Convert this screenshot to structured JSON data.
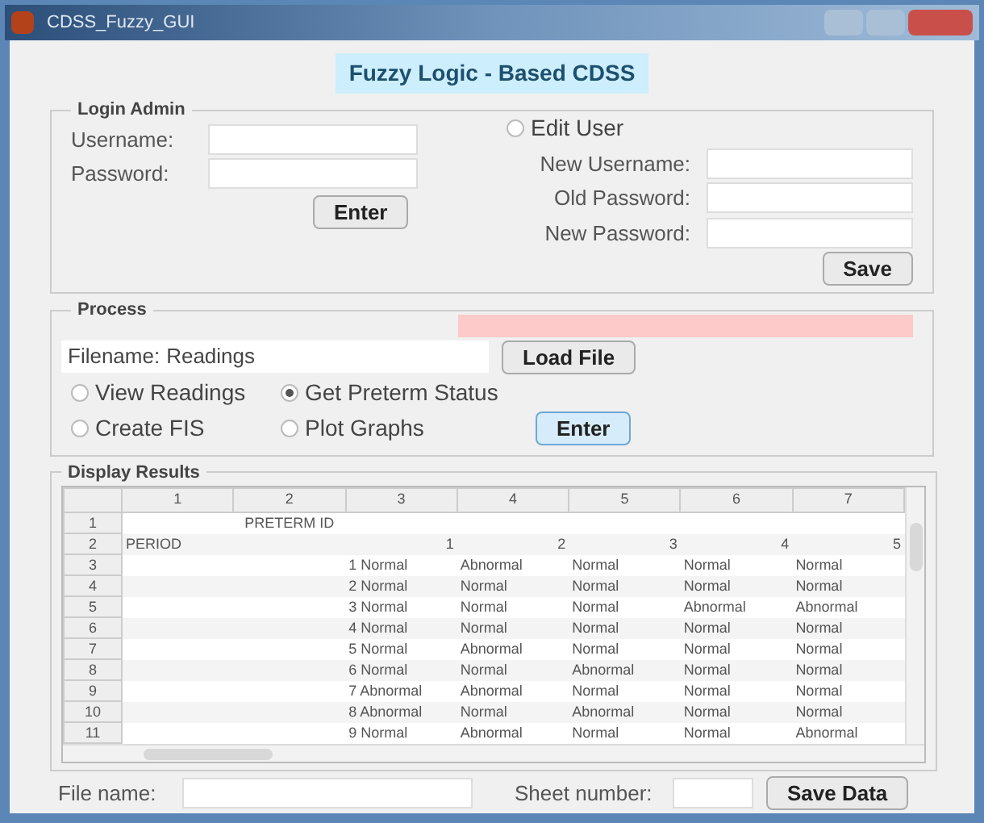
{
  "window": {
    "title": "CDSS_Fuzzy_GUI"
  },
  "heading": "Fuzzy Logic - Based CDSS",
  "login": {
    "title": "Login Admin",
    "fields": [
      {
        "label": "Username:"
      },
      {
        "label": "Password:"
      }
    ],
    "button": "Enter",
    "edit_user": {
      "label": "Edit User",
      "selected": false
    },
    "edit_fields": [
      {
        "label": "New Username:"
      },
      {
        "label": "Old Password:"
      },
      {
        "label": "New Password:"
      }
    ],
    "save_button": "Save"
  },
  "process": {
    "title": "Process",
    "filename_label": "Filename:",
    "filename_value": "Readings",
    "load_button": "Load File",
    "options": [
      {
        "label": "View Readings",
        "selected": false
      },
      {
        "label": "Get Preterm Status",
        "selected": true
      },
      {
        "label": "Create FIS",
        "selected": false
      },
      {
        "label": "Plot Graphs",
        "selected": false
      }
    ],
    "enter_button": "Enter"
  },
  "results": {
    "title": "Display Results",
    "columns": [
      "1",
      "2",
      "3",
      "4",
      "5",
      "6",
      "7"
    ],
    "rows": [
      {
        "label": "1",
        "cells": [
          "",
          "PRETERM ID",
          "",
          "",
          "",
          "",
          ""
        ]
      },
      {
        "label": "2",
        "cells": [
          "PERIOD",
          "",
          "1",
          "2",
          "3",
          "4",
          "5"
        ]
      },
      {
        "label": "3",
        "cells": [
          "",
          "",
          "1 Normal",
          "Abnormal",
          "Normal",
          "Normal",
          "Normal"
        ]
      },
      {
        "label": "4",
        "cells": [
          "",
          "",
          "2 Normal",
          "Normal",
          "Normal",
          "Normal",
          "Normal"
        ]
      },
      {
        "label": "5",
        "cells": [
          "",
          "",
          "3 Normal",
          "Normal",
          "Normal",
          "Abnormal",
          "Abnormal"
        ]
      },
      {
        "label": "6",
        "cells": [
          "",
          "",
          "4 Normal",
          "Normal",
          "Normal",
          "Normal",
          "Normal"
        ]
      },
      {
        "label": "7",
        "cells": [
          "",
          "",
          "5 Normal",
          "Abnormal",
          "Normal",
          "Normal",
          "Normal"
        ]
      },
      {
        "label": "8",
        "cells": [
          "",
          "",
          "6 Normal",
          "Normal",
          "Abnormal",
          "Normal",
          "Normal"
        ]
      },
      {
        "label": "9",
        "cells": [
          "",
          "",
          "7 Abnormal",
          "Abnormal",
          "Normal",
          "Normal",
          "Normal"
        ]
      },
      {
        "label": "10",
        "cells": [
          "",
          "",
          "8 Abnormal",
          "Normal",
          "Abnormal",
          "Normal",
          "Normal"
        ]
      },
      {
        "label": "11",
        "cells": [
          "",
          "",
          "9 Normal",
          "Abnormal",
          "Normal",
          "Normal",
          "Abnormal"
        ]
      }
    ]
  },
  "footer": {
    "file_label": "File name:",
    "sheet_label": "Sheet number:",
    "save_button": "Save Data"
  }
}
